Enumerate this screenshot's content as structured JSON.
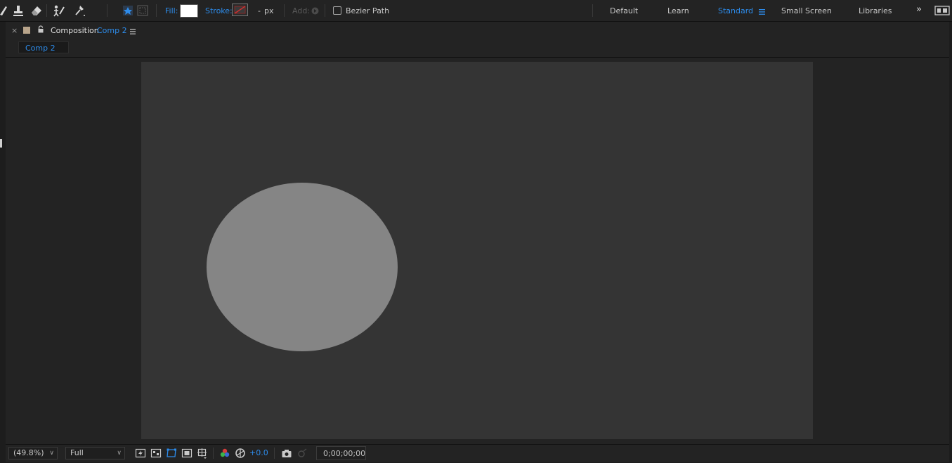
{
  "toolbar": {
    "fill_label": "Fill:",
    "stroke_label": "Stroke:",
    "stroke_width": "-",
    "stroke_unit": "px",
    "add_label": "Add:",
    "bezier_label": "Bezier Path",
    "bezier_checked": false,
    "fill_color": "#ffffff",
    "accent_color": "#2d8ceb"
  },
  "workspaces": {
    "items": [
      "Default",
      "Learn",
      "Standard",
      "Small Screen",
      "Libraries"
    ],
    "active": "Standard"
  },
  "panel": {
    "close_glyph": "×",
    "title": "Composition",
    "comp_name": "Comp 2",
    "tab_label": "Comp 2"
  },
  "viewer": {
    "background_color": "#343434",
    "shape": {
      "type": "ellipse",
      "fill": "#858585"
    }
  },
  "bottom_bar": {
    "zoom": "(49.8%)",
    "resolution": "Full",
    "exposure": "+0.0",
    "timecode": "0;00;00;00"
  }
}
